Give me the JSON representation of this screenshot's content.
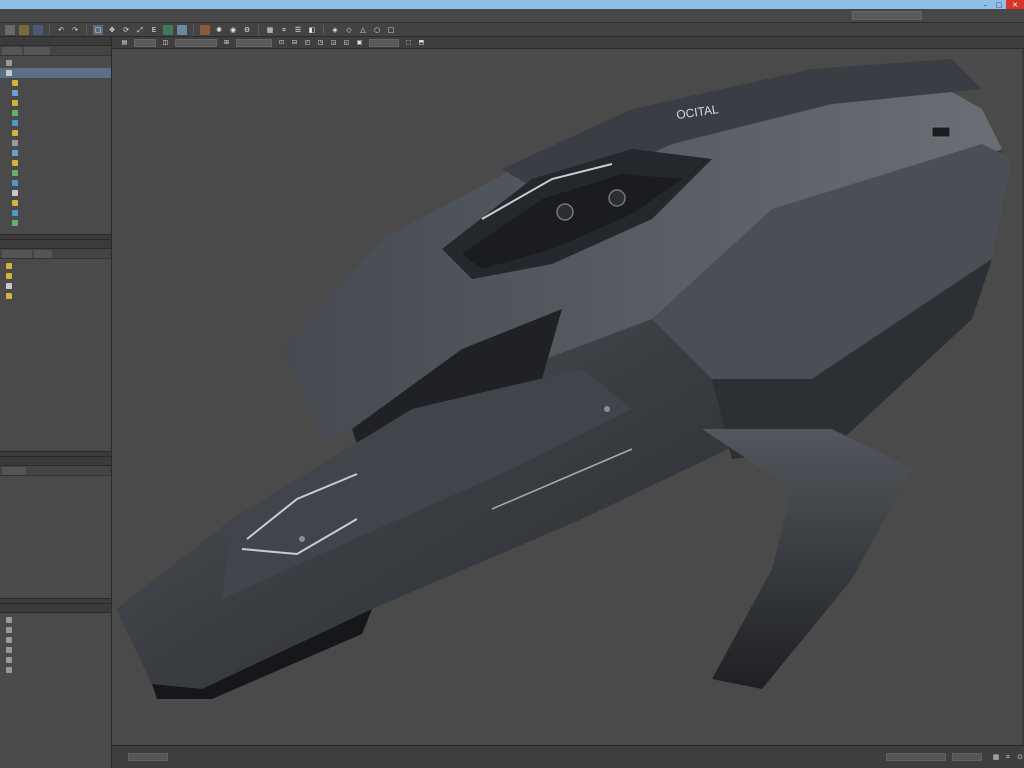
{
  "window": {
    "title": "",
    "controls": {
      "minimize": "–",
      "maximize": "□",
      "close": "✕"
    }
  },
  "menubar": {
    "items": [
      "",
      "",
      "",
      "",
      "",
      "",
      "",
      "",
      "",
      "",
      "",
      "",
      "",
      "",
      "",
      "",
      "",
      ""
    ]
  },
  "toolbar": {
    "text_glyph": "E",
    "icons": [
      "new-icon",
      "open-icon",
      "save-icon",
      "undo-icon",
      "redo-icon",
      "select-icon",
      "move-icon",
      "rotate-icon",
      "scale-icon",
      "text-icon",
      "image-icon",
      "render-icon",
      "material-icon",
      "light-icon",
      "camera-icon",
      "settings-icon"
    ]
  },
  "left_panel": {
    "scene_tree_rows": 17,
    "layers_rows": 6,
    "bottom_rows": 7
  },
  "viewport": {
    "model_label": "OCITAL",
    "background": "#4a4a4a",
    "hull_color": "#2f3236",
    "hull_highlight": "#62666c",
    "accent_line": "#c9ccd0"
  },
  "statusbar": {
    "text": ""
  }
}
